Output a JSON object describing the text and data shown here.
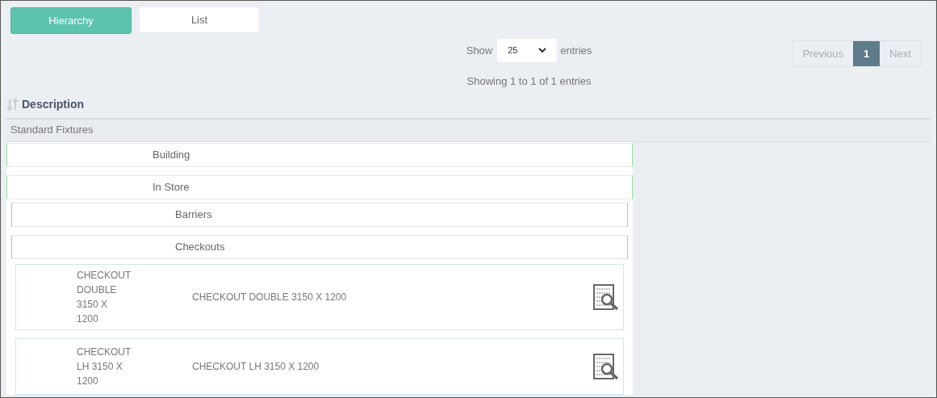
{
  "view_tabs": [
    {
      "label": "Hierarchy",
      "selected": true
    },
    {
      "label": "List",
      "selected": false
    }
  ],
  "length": {
    "prefix": "Show",
    "value": "25",
    "suffix": "entries"
  },
  "info": "Showing 1 to 1 of 1 entries",
  "pagination": [
    {
      "label": "Previous",
      "selected": false,
      "disabled": true
    },
    {
      "label": "1",
      "selected": true,
      "disabled": false
    },
    {
      "label": "Next",
      "selected": false,
      "disabled": true
    }
  ],
  "table": {
    "column": "Description",
    "group": "Standard Fixtures",
    "tree": [
      {
        "label": "Building"
      },
      {
        "label": "In Store",
        "children": [
          {
            "label": "Barriers"
          },
          {
            "label": "Checkouts",
            "items": [
              {
                "code": "CHECKOUT DOUBLE 3150 X 1200",
                "description": "CHECKOUT DOUBLE 3150 X 1200"
              },
              {
                "code": "CHECKOUT LH 3150 X 1200",
                "description": "CHECKOUT LH 3150 X 1200"
              }
            ]
          }
        ]
      }
    ]
  }
}
